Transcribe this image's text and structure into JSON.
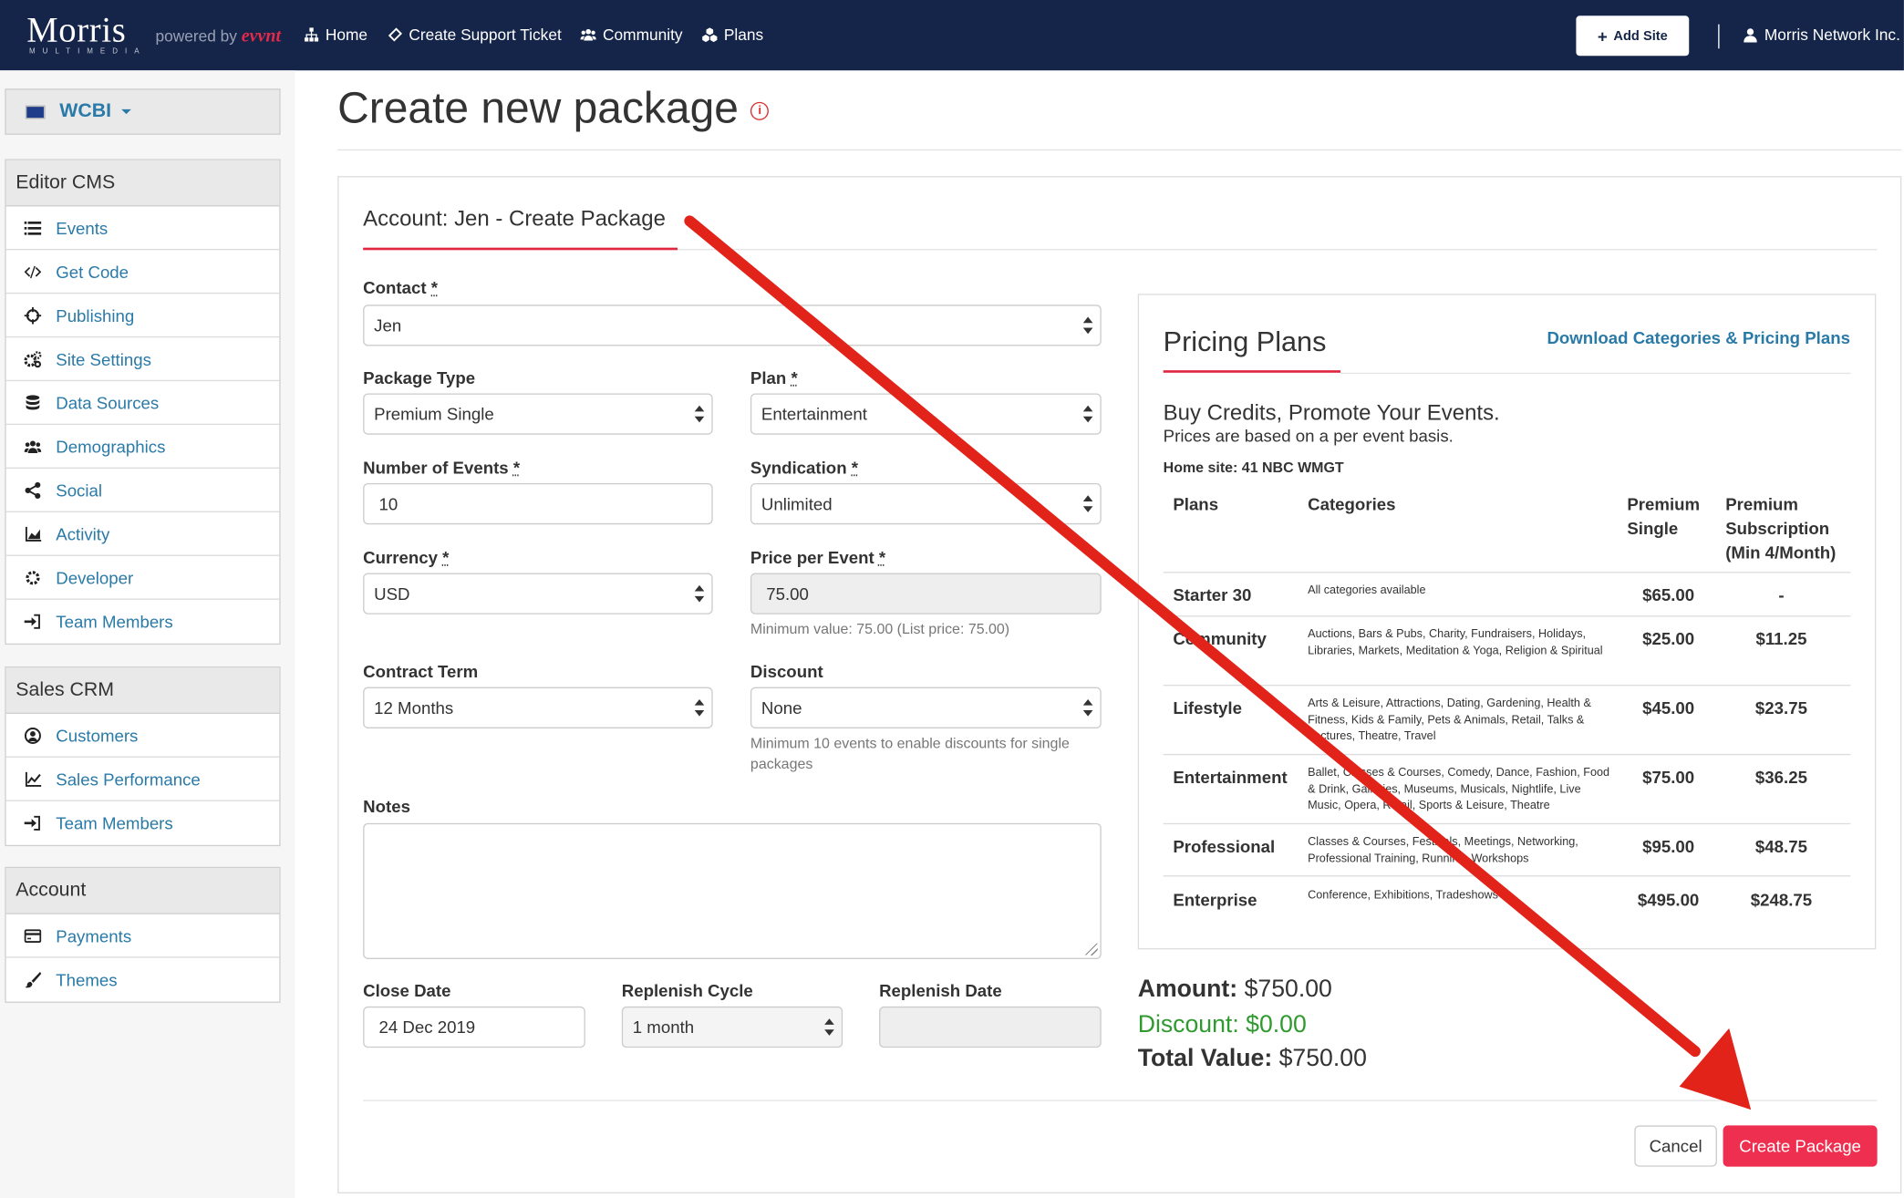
{
  "topnav": {
    "logo": "Morris",
    "logo_sub": "MULTIMEDIA",
    "powered_by": "powered by",
    "powered_brand": "evvnt",
    "links": [
      {
        "label": "Home",
        "icon": "sitemap-icon"
      },
      {
        "label": "Create Support Ticket",
        "icon": "ticket-icon"
      },
      {
        "label": "Community",
        "icon": "users-icon"
      },
      {
        "label": "Plans",
        "icon": "cubes-icon"
      }
    ],
    "add_site": "Add Site",
    "account": "Morris Network Inc."
  },
  "sidebar": {
    "site": "WCBI",
    "sections": [
      {
        "title": "Editor CMS",
        "items": [
          {
            "label": "Events",
            "icon": "list-icon"
          },
          {
            "label": "Get Code",
            "icon": "code-icon"
          },
          {
            "label": "Publishing",
            "icon": "crosshairs-icon"
          },
          {
            "label": "Site Settings",
            "icon": "cogs-icon"
          },
          {
            "label": "Data Sources",
            "icon": "database-icon"
          },
          {
            "label": "Demographics",
            "icon": "users-icon"
          },
          {
            "label": "Social",
            "icon": "share-icon"
          },
          {
            "label": "Activity",
            "icon": "area-chart-icon"
          },
          {
            "label": "Developer",
            "icon": "gear-icon"
          },
          {
            "label": "Team Members",
            "icon": "sign-in-icon"
          }
        ]
      },
      {
        "title": "Sales CRM",
        "items": [
          {
            "label": "Customers",
            "icon": "user-circle-icon"
          },
          {
            "label": "Sales Performance",
            "icon": "line-chart-icon"
          },
          {
            "label": "Team Members",
            "icon": "sign-in-icon"
          }
        ]
      },
      {
        "title": "Account",
        "items": [
          {
            "label": "Payments",
            "icon": "credit-card-icon"
          },
          {
            "label": "Themes",
            "icon": "paint-brush-icon"
          }
        ]
      }
    ]
  },
  "page": {
    "title": "Create new package",
    "account_heading": "Account: Jen - Create Package"
  },
  "form": {
    "contact": {
      "label": "Contact",
      "value": "Jen"
    },
    "package_type": {
      "label": "Package Type",
      "value": "Premium Single"
    },
    "plan": {
      "label": "Plan",
      "value": "Entertainment"
    },
    "num_events": {
      "label": "Number of Events",
      "value": "10"
    },
    "syndication": {
      "label": "Syndication",
      "value": "Unlimited"
    },
    "currency": {
      "label": "Currency",
      "value": "USD"
    },
    "price_per_event": {
      "label": "Price per Event",
      "value": "75.00",
      "help": "Minimum value: 75.00 (List price: 75.00)"
    },
    "contract_term": {
      "label": "Contract Term",
      "value": "12 Months"
    },
    "discount": {
      "label": "Discount",
      "value": "None",
      "help": "Minimum 10 events to enable discounts for single packages"
    },
    "notes": {
      "label": "Notes",
      "value": ""
    },
    "close_date": {
      "label": "Close Date",
      "value": "24 Dec 2019"
    },
    "replenish_cycle": {
      "label": "Replenish Cycle",
      "value": "1 month"
    },
    "replenish_date": {
      "label": "Replenish Date",
      "value": ""
    },
    "required_mark": "*"
  },
  "pricing": {
    "title": "Pricing Plans",
    "download_link": "Download Categories & Pricing Plans",
    "headline": "Buy Credits, Promote Your Events.",
    "subline": "Prices are based on a per event basis.",
    "home_site": "Home site: 41 NBC WMGT",
    "columns": [
      "Plans",
      "Categories",
      "Premium Single",
      "Premium Subscription (Min 4/Month)"
    ],
    "rows": [
      {
        "plan": "Starter 30",
        "categories": "All categories available",
        "single": "$65.00",
        "subscription": "-"
      },
      {
        "plan": "Community",
        "categories": "Auctions, Bars & Pubs, Charity, Fundraisers, Holidays, Libraries, Markets, Meditation & Yoga, Religion & Spiritual",
        "single": "$25.00",
        "subscription": "$11.25"
      },
      {
        "plan": "Lifestyle",
        "categories": "Arts & Leisure, Attractions, Dating, Gardening, Health & Fitness, Kids & Family, Pets & Animals, Retail, Talks & Lectures, Theatre, Travel",
        "single": "$45.00",
        "subscription": "$23.75"
      },
      {
        "plan": "Entertainment",
        "categories": "Ballet, Classes & Courses, Comedy, Dance, Fashion, Food & Drink, Galleries, Museums, Musicals, Nightlife, Live Music, Opera, Retail, Sports & Leisure, Theatre",
        "single": "$75.00",
        "subscription": "$36.25"
      },
      {
        "plan": "Professional",
        "categories": "Classes & Courses, Festivals, Meetings, Networking, Professional Training, Running, Workshops",
        "single": "$95.00",
        "subscription": "$48.75"
      },
      {
        "plan": "Enterprise",
        "categories": "Conference, Exhibitions, Tradeshows",
        "single": "$495.00",
        "subscription": "$248.75"
      }
    ]
  },
  "summary": {
    "amount_label": "Amount:",
    "amount": "$750.00",
    "discount_label": "Discount:",
    "discount": "$0.00",
    "total_label": "Total Value:",
    "total": "$750.00"
  },
  "actions": {
    "cancel": "Cancel",
    "create": "Create Package"
  },
  "colors": {
    "navbar": "#152449",
    "accent_red": "#e0273f",
    "link_blue": "#2a7aa8",
    "create_button": "#ee2f4f",
    "discount_green": "#2f9a2f",
    "annotation_arrow": "#e2231a"
  }
}
